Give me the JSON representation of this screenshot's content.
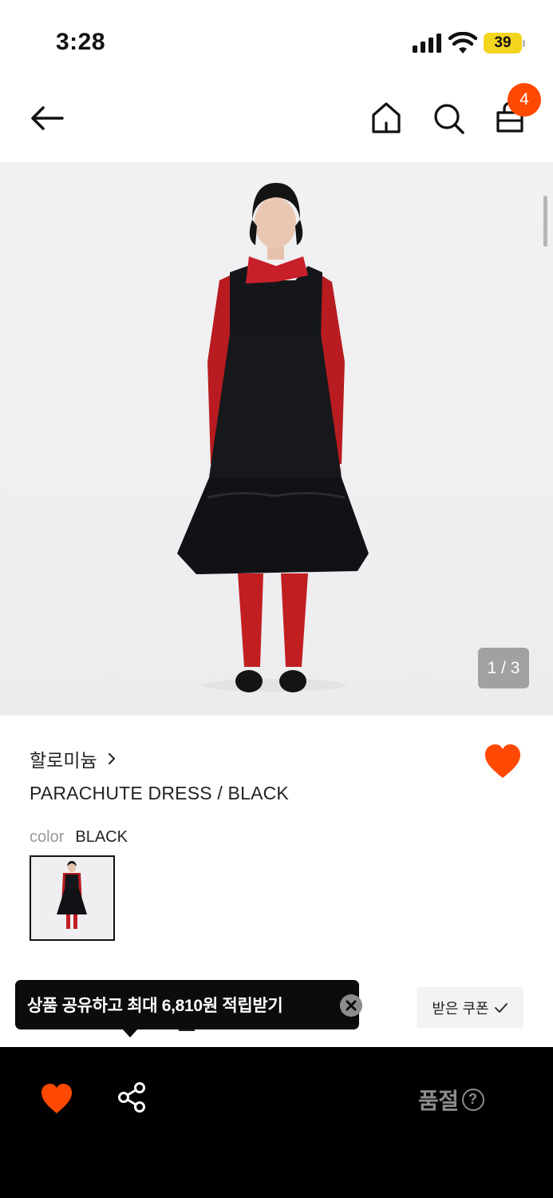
{
  "status_bar": {
    "time": "3:28",
    "battery_level": "39",
    "battery_color": "#f3d41f"
  },
  "nav": {
    "back_icon": "arrow-left-icon",
    "home_icon": "home-icon",
    "search_icon": "search-icon",
    "bag_icon": "shopping-bag-icon",
    "cart_count": "4",
    "badge_color": "#ff4800"
  },
  "gallery": {
    "page_indicator": "1 / 3"
  },
  "product": {
    "brand": "할로미늄",
    "name": "PARACHUTE DRESS / BLACK",
    "color_label": "color",
    "color_value": "BLACK",
    "liked": true,
    "like_color": "#ff4800"
  },
  "share_tooltip": {
    "text": "상품 공유하고 최대 6,810원 적립받기"
  },
  "coupon": {
    "label": "받은 쿠폰"
  },
  "bottom_bar": {
    "status_label": "품절",
    "help_icon_text": "?"
  }
}
